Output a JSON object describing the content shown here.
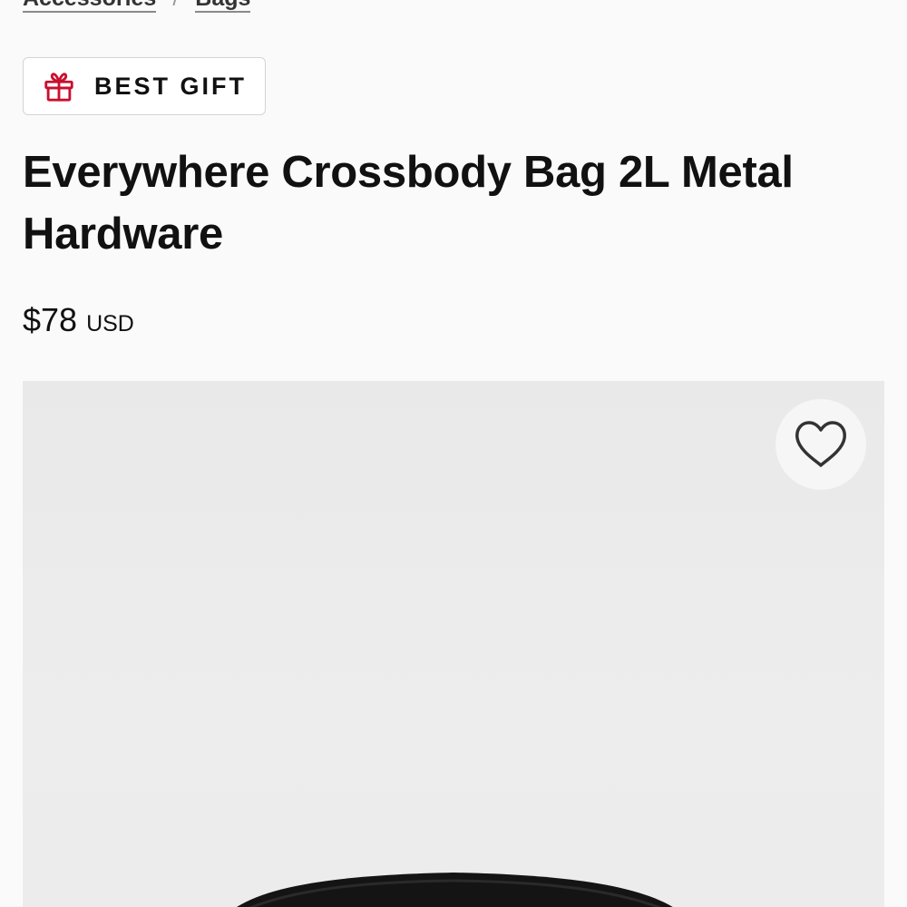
{
  "breadcrumb": {
    "items": [
      {
        "label": "Accessories"
      },
      {
        "label": "Bags"
      }
    ],
    "separator": "/"
  },
  "badge": {
    "icon": "gift-icon",
    "label": "BEST GIFT",
    "icon_color": "#c8102e"
  },
  "product": {
    "title": "Everywhere Crossbody Bag 2L Metal Hardware",
    "price": {
      "amount": "$78",
      "currency": "USD"
    }
  },
  "media": {
    "wishlist_icon": "heart-outline-icon"
  }
}
